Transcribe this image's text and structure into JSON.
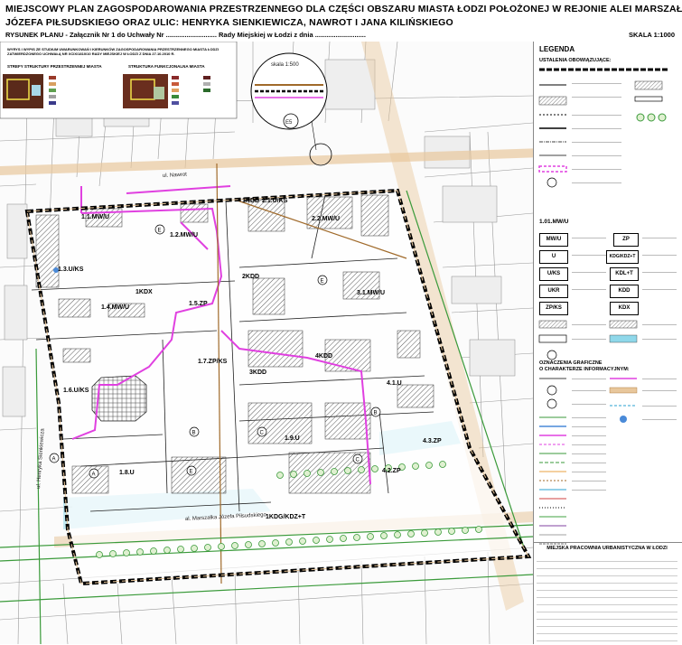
{
  "header": {
    "title_line1": "MIEJSCOWY PLAN ZAGOSPODAROWANIA PRZESTRZENNEGO DLA CZĘŚCI OBSZARU MIASTA ŁODZI POŁOŻONEJ W REJONIE ALEI MARSZAŁKA",
    "title_line2": "JÓZEFA PIŁSUDSKIEGO ORAZ ULIC: HENRYKA SIENKIEWICZA, NAWROT I JANA KILIŃSKIEGO",
    "subline": "RYSUNEK PLANU - Załącznik Nr 1 do Uchwały Nr ........................... Rady Miejskiej w Łodzi z dnia ...........................",
    "scale": "SKALA   1:1000"
  },
  "inset": {
    "note": "WYRYS I WYPIS ZE STUDIUM UWARUNKOWAŃ I KIERUNKÓW ZAGOSPODAROWANIA PRZESTRZENNEGO MIASTA ŁODZI ZATWIERDZONEGO UCHWAŁĄ NR XCIX/1810/10 RADY MIEJSKIEJ W ŁODZI Z DNIA 27.10.2010 R.",
    "left_title": "STREFY STRUKTURY PRZESTRZENNEJ MIASTA",
    "right_title": "STRUKTURA FUNKCJONALNA MIASTA",
    "scale_detail": "skala 1:500",
    "detail_code": "E5"
  },
  "map": {
    "street_pilsudskiego": "al. Marszałka Józefa Piłsudskiego",
    "street_sienkiewicza": "ul. Henryka Sienkiewicza",
    "street_nawrot": "ul. Nawrot",
    "zones": [
      {
        "label": "1.1.MW/U"
      },
      {
        "label": "1.2.MW/U"
      },
      {
        "label": "1KDD"
      },
      {
        "label": "2.1.U/KS"
      },
      {
        "label": "2.2.MW/U"
      },
      {
        "label": "1.3.U/KS"
      },
      {
        "label": "1KDX"
      },
      {
        "label": "2KDD"
      },
      {
        "label": "3.1.MW/U"
      },
      {
        "label": "1.5.ZP"
      },
      {
        "label": "1.4.MW/U"
      },
      {
        "label": "1.7.ZP/KS"
      },
      {
        "label": "3KDD"
      },
      {
        "label": "4KDD"
      },
      {
        "label": "1.6.U/KS"
      },
      {
        "label": "4.1.U"
      },
      {
        "label": "1.9.U"
      },
      {
        "label": "4.2.ZP"
      },
      {
        "label": "1.8.U"
      },
      {
        "label": "4.3.ZP"
      },
      {
        "label": "1KDG/KDZ+T"
      }
    ],
    "circle_markers": [
      "E",
      "E",
      "A",
      "B",
      "B",
      "C",
      "A",
      "C",
      "E"
    ]
  },
  "legend": {
    "title": "LEGENDA",
    "section1": "USTALENIA OBOWIĄZUJĄCE:",
    "zone_example": "1.01.MW/U",
    "codes_left": [
      "MW/U",
      "U",
      "U/KS",
      "UKR",
      "ZP/KS"
    ],
    "codes_right": [
      "ZP",
      "KDG/KDZ+T",
      "KDL+T",
      "KDD",
      "KDX"
    ],
    "section2_line1": "OZNACZENIA GRAFICZNE",
    "section2_line2": "O CHARAKTERZE INFORMACYJNYM:"
  },
  "titleblock": {
    "office": "MIEJSKA PRACOWNIA URBANISTYCZNA W ŁODZI"
  },
  "colors": {
    "boundary": "#000000",
    "pink_line": "#e040e0",
    "green_line": "#3a9a3a",
    "cyan_area": "#8fd8ea",
    "brown_line": "#a06a2a",
    "tan_band": "#e8c79c"
  }
}
